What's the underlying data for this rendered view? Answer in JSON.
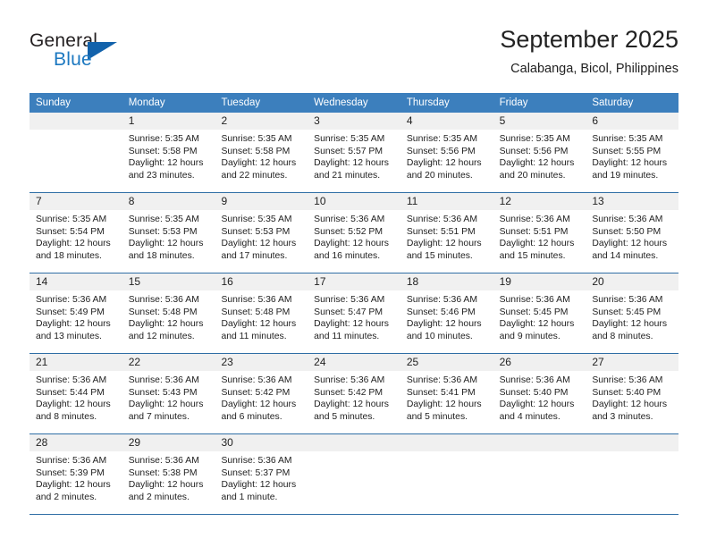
{
  "logo": {
    "word_top": "General",
    "word_bottom": "Blue",
    "accent_color": "#1262ab"
  },
  "header": {
    "title": "September 2025",
    "subtitle": "Calabanga, Bicol, Philippines"
  },
  "calendar": {
    "header_bg": "#3c7fbd",
    "daynum_bg": "#f0f0f0",
    "weekdays": [
      "Sunday",
      "Monday",
      "Tuesday",
      "Wednesday",
      "Thursday",
      "Friday",
      "Saturday"
    ],
    "weeks": [
      [
        {
          "day": "",
          "sunrise": "",
          "sunset": "",
          "daylight1": "",
          "daylight2": ""
        },
        {
          "day": "1",
          "sunrise": "Sunrise: 5:35 AM",
          "sunset": "Sunset: 5:58 PM",
          "daylight1": "Daylight: 12 hours",
          "daylight2": "and 23 minutes."
        },
        {
          "day": "2",
          "sunrise": "Sunrise: 5:35 AM",
          "sunset": "Sunset: 5:58 PM",
          "daylight1": "Daylight: 12 hours",
          "daylight2": "and 22 minutes."
        },
        {
          "day": "3",
          "sunrise": "Sunrise: 5:35 AM",
          "sunset": "Sunset: 5:57 PM",
          "daylight1": "Daylight: 12 hours",
          "daylight2": "and 21 minutes."
        },
        {
          "day": "4",
          "sunrise": "Sunrise: 5:35 AM",
          "sunset": "Sunset: 5:56 PM",
          "daylight1": "Daylight: 12 hours",
          "daylight2": "and 20 minutes."
        },
        {
          "day": "5",
          "sunrise": "Sunrise: 5:35 AM",
          "sunset": "Sunset: 5:56 PM",
          "daylight1": "Daylight: 12 hours",
          "daylight2": "and 20 minutes."
        },
        {
          "day": "6",
          "sunrise": "Sunrise: 5:35 AM",
          "sunset": "Sunset: 5:55 PM",
          "daylight1": "Daylight: 12 hours",
          "daylight2": "and 19 minutes."
        }
      ],
      [
        {
          "day": "7",
          "sunrise": "Sunrise: 5:35 AM",
          "sunset": "Sunset: 5:54 PM",
          "daylight1": "Daylight: 12 hours",
          "daylight2": "and 18 minutes."
        },
        {
          "day": "8",
          "sunrise": "Sunrise: 5:35 AM",
          "sunset": "Sunset: 5:53 PM",
          "daylight1": "Daylight: 12 hours",
          "daylight2": "and 18 minutes."
        },
        {
          "day": "9",
          "sunrise": "Sunrise: 5:35 AM",
          "sunset": "Sunset: 5:53 PM",
          "daylight1": "Daylight: 12 hours",
          "daylight2": "and 17 minutes."
        },
        {
          "day": "10",
          "sunrise": "Sunrise: 5:36 AM",
          "sunset": "Sunset: 5:52 PM",
          "daylight1": "Daylight: 12 hours",
          "daylight2": "and 16 minutes."
        },
        {
          "day": "11",
          "sunrise": "Sunrise: 5:36 AM",
          "sunset": "Sunset: 5:51 PM",
          "daylight1": "Daylight: 12 hours",
          "daylight2": "and 15 minutes."
        },
        {
          "day": "12",
          "sunrise": "Sunrise: 5:36 AM",
          "sunset": "Sunset: 5:51 PM",
          "daylight1": "Daylight: 12 hours",
          "daylight2": "and 15 minutes."
        },
        {
          "day": "13",
          "sunrise": "Sunrise: 5:36 AM",
          "sunset": "Sunset: 5:50 PM",
          "daylight1": "Daylight: 12 hours",
          "daylight2": "and 14 minutes."
        }
      ],
      [
        {
          "day": "14",
          "sunrise": "Sunrise: 5:36 AM",
          "sunset": "Sunset: 5:49 PM",
          "daylight1": "Daylight: 12 hours",
          "daylight2": "and 13 minutes."
        },
        {
          "day": "15",
          "sunrise": "Sunrise: 5:36 AM",
          "sunset": "Sunset: 5:48 PM",
          "daylight1": "Daylight: 12 hours",
          "daylight2": "and 12 minutes."
        },
        {
          "day": "16",
          "sunrise": "Sunrise: 5:36 AM",
          "sunset": "Sunset: 5:48 PM",
          "daylight1": "Daylight: 12 hours",
          "daylight2": "and 11 minutes."
        },
        {
          "day": "17",
          "sunrise": "Sunrise: 5:36 AM",
          "sunset": "Sunset: 5:47 PM",
          "daylight1": "Daylight: 12 hours",
          "daylight2": "and 11 minutes."
        },
        {
          "day": "18",
          "sunrise": "Sunrise: 5:36 AM",
          "sunset": "Sunset: 5:46 PM",
          "daylight1": "Daylight: 12 hours",
          "daylight2": "and 10 minutes."
        },
        {
          "day": "19",
          "sunrise": "Sunrise: 5:36 AM",
          "sunset": "Sunset: 5:45 PM",
          "daylight1": "Daylight: 12 hours",
          "daylight2": "and 9 minutes."
        },
        {
          "day": "20",
          "sunrise": "Sunrise: 5:36 AM",
          "sunset": "Sunset: 5:45 PM",
          "daylight1": "Daylight: 12 hours",
          "daylight2": "and 8 minutes."
        }
      ],
      [
        {
          "day": "21",
          "sunrise": "Sunrise: 5:36 AM",
          "sunset": "Sunset: 5:44 PM",
          "daylight1": "Daylight: 12 hours",
          "daylight2": "and 8 minutes."
        },
        {
          "day": "22",
          "sunrise": "Sunrise: 5:36 AM",
          "sunset": "Sunset: 5:43 PM",
          "daylight1": "Daylight: 12 hours",
          "daylight2": "and 7 minutes."
        },
        {
          "day": "23",
          "sunrise": "Sunrise: 5:36 AM",
          "sunset": "Sunset: 5:42 PM",
          "daylight1": "Daylight: 12 hours",
          "daylight2": "and 6 minutes."
        },
        {
          "day": "24",
          "sunrise": "Sunrise: 5:36 AM",
          "sunset": "Sunset: 5:42 PM",
          "daylight1": "Daylight: 12 hours",
          "daylight2": "and 5 minutes."
        },
        {
          "day": "25",
          "sunrise": "Sunrise: 5:36 AM",
          "sunset": "Sunset: 5:41 PM",
          "daylight1": "Daylight: 12 hours",
          "daylight2": "and 5 minutes."
        },
        {
          "day": "26",
          "sunrise": "Sunrise: 5:36 AM",
          "sunset": "Sunset: 5:40 PM",
          "daylight1": "Daylight: 12 hours",
          "daylight2": "and 4 minutes."
        },
        {
          "day": "27",
          "sunrise": "Sunrise: 5:36 AM",
          "sunset": "Sunset: 5:40 PM",
          "daylight1": "Daylight: 12 hours",
          "daylight2": "and 3 minutes."
        }
      ],
      [
        {
          "day": "28",
          "sunrise": "Sunrise: 5:36 AM",
          "sunset": "Sunset: 5:39 PM",
          "daylight1": "Daylight: 12 hours",
          "daylight2": "and 2 minutes."
        },
        {
          "day": "29",
          "sunrise": "Sunrise: 5:36 AM",
          "sunset": "Sunset: 5:38 PM",
          "daylight1": "Daylight: 12 hours",
          "daylight2": "and 2 minutes."
        },
        {
          "day": "30",
          "sunrise": "Sunrise: 5:36 AM",
          "sunset": "Sunset: 5:37 PM",
          "daylight1": "Daylight: 12 hours",
          "daylight2": "and 1 minute."
        },
        {
          "day": "",
          "sunrise": "",
          "sunset": "",
          "daylight1": "",
          "daylight2": ""
        },
        {
          "day": "",
          "sunrise": "",
          "sunset": "",
          "daylight1": "",
          "daylight2": ""
        },
        {
          "day": "",
          "sunrise": "",
          "sunset": "",
          "daylight1": "",
          "daylight2": ""
        },
        {
          "day": "",
          "sunrise": "",
          "sunset": "",
          "daylight1": "",
          "daylight2": ""
        }
      ]
    ]
  }
}
